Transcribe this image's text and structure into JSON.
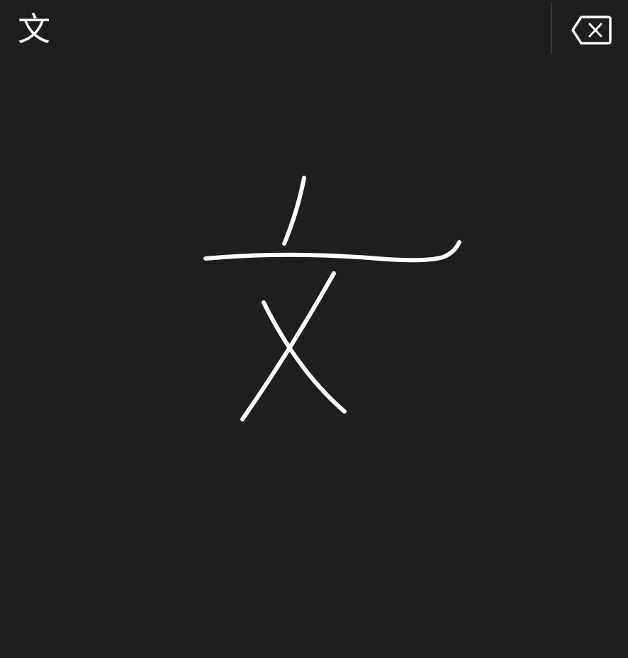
{
  "keyboard": {
    "language_key": {
      "label": "文",
      "icon": "language-switch-icon"
    },
    "delete_key": {
      "icon": "delete-backward-icon"
    },
    "handwriting_area": {
      "ink_color": "#ffffff",
      "background_color": "#1e1d20",
      "strokes": [
        "stroke-dot",
        "stroke-horizontal",
        "stroke-left-falling",
        "stroke-right-falling"
      ]
    }
  }
}
